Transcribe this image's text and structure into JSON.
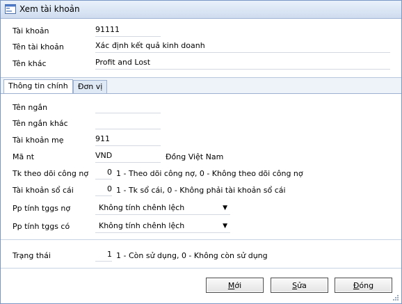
{
  "window": {
    "title": "Xem tài khoản"
  },
  "header": {
    "account_label": "Tài khoản",
    "account_value": "91111",
    "name_label": "Tên tài khoản",
    "name_value": "Xác định kết quả kinh doanh",
    "other_label": "Tên khác",
    "other_value": "Profit and Lost"
  },
  "tabs": [
    {
      "label": "Thông tin chính",
      "active": true
    },
    {
      "label": "Đơn vị",
      "active": false
    }
  ],
  "main": {
    "short_name_label": "Tên ngắn",
    "short_name_value": "",
    "short_other_label": "Tên ngắn khác",
    "short_other_value": "",
    "parent_label": "Tài khoản mẹ",
    "parent_value": "911",
    "currency_label": "Mã nt",
    "currency_value": "VND",
    "currency_name": "Đồng Việt Nam",
    "debt_label": "Tk theo dõi công nợ",
    "debt_value": "0",
    "debt_desc": "1 - Theo dõi công nợ, 0 - Không theo dõi công nợ",
    "ledger_label": "Tài khoản sổ cái",
    "ledger_value": "0",
    "ledger_desc": "1 - Tk sổ cái, 0 - Không phải tài khoản sổ cái",
    "pp_debit_label": "Pp tính tggs nợ",
    "pp_debit_value": "Không tính chênh lệch",
    "pp_credit_label": "Pp tính tggs có",
    "pp_credit_value": "Không tính chênh lệch"
  },
  "status": {
    "label": "Trạng thái",
    "value": "1",
    "desc": "1 - Còn sử dụng, 0 - Không còn sử dụng"
  },
  "buttons": {
    "new": {
      "label": "Mới",
      "access_key": "M",
      "rest": "ới"
    },
    "edit": {
      "label": "Sửa",
      "access_key": "S",
      "rest": "ửa"
    },
    "close": {
      "label": "Đóng",
      "access_key": "Đ",
      "rest": "óng"
    }
  },
  "colors": {
    "title_bg": "#cfdcef",
    "border": "#7a96c4",
    "field_underline": "#d4d8e0"
  }
}
